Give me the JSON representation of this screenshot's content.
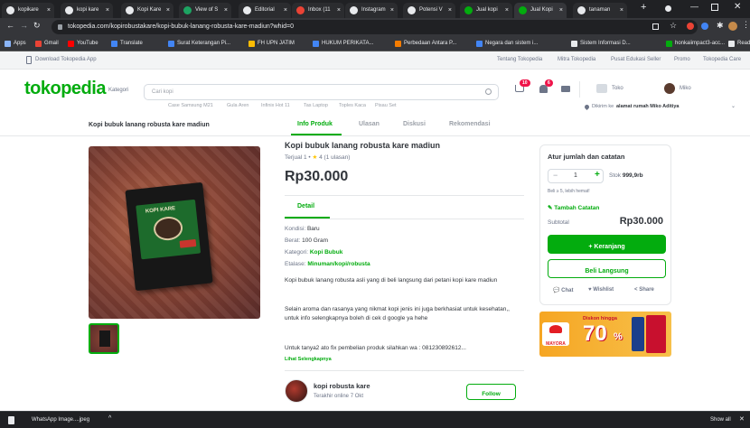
{
  "browser": {
    "tabs": [
      {
        "label": "kopikare",
        "color": "#e8eaed"
      },
      {
        "label": "kopi kare",
        "color": "#e8eaed"
      },
      {
        "label": "Kopi Kare",
        "color": "#e8eaed"
      },
      {
        "label": "View of S",
        "color": "#1da462"
      },
      {
        "label": "Editorial",
        "color": "#e8eaed"
      },
      {
        "label": "Inbox (11",
        "color": "#ea4335"
      },
      {
        "label": "Instagram",
        "color": "#e8eaed"
      },
      {
        "label": "Potensi V",
        "color": "#e8eaed"
      },
      {
        "label": "Jual kopi",
        "color": "#03ac0e"
      },
      {
        "label": "Jual Kopi",
        "color": "#03ac0e"
      },
      {
        "label": "tanaman",
        "color": "#e8eaed"
      }
    ],
    "url": "tokopedia.com/kopirobustakare/kopi-bubuk-lanang-robusta-kare-madiun?whid=0",
    "bookmarks": [
      {
        "label": "Apps",
        "color": "#8ab4f8"
      },
      {
        "label": "Gmail",
        "color": "#ea4335"
      },
      {
        "label": "YouTube",
        "color": "#ff0000"
      },
      {
        "label": "Translate",
        "color": "#4285f4"
      },
      {
        "label": "Surat Keterangan Pi...",
        "color": "#4285f4"
      },
      {
        "label": "FH UPN JATIM",
        "color": "#fbbc04"
      },
      {
        "label": "HUKUM PERIKATA...",
        "color": "#4285f4"
      },
      {
        "label": "Perbedaan Antara P...",
        "color": "#f57c00"
      },
      {
        "label": "Negara dan sistem i...",
        "color": "#4285f4"
      },
      {
        "label": "Sistem Informasi D...",
        "color": "#e8eaed"
      },
      {
        "label": "honkaiimpact3-acc...",
        "color": "#03ac0e"
      },
      {
        "label": "Reading list",
        "color": "#e8eaed"
      }
    ]
  },
  "topstrip": {
    "download_app": "Download Tokopedia App",
    "links": [
      "Tentang Tokopedia",
      "Mitra Tokopedia",
      "Pusat Edukasi Seller",
      "Promo",
      "Tokopedia Care"
    ]
  },
  "header": {
    "logo": "tokopedia",
    "category": "Kategori",
    "search_placeholder": "Cari kopi",
    "suggestions": [
      "Case Samsung M21",
      "Gula Aren",
      "Infinix Hot 11",
      "Tas Laptop",
      "Toples Kaca",
      "Pisau Set"
    ],
    "cart_badge": "10",
    "notif_badge": "6",
    "shop": "Toko",
    "user": "Miko",
    "ship_to_prefix": "Dikirim ke",
    "ship_to": "alamat rumah Miko Aditiya"
  },
  "subnav": {
    "product_title": "Kopi bubuk lanang robusta kare madiun",
    "tabs": [
      "Info Produk",
      "Ulasan",
      "Diskusi",
      "Rekomendasi"
    ]
  },
  "product": {
    "title": "Kopi bubuk lanang robusta kare madiun",
    "sold": "Terjual 1",
    "rating": "4",
    "reviews": "(1 ulasan)",
    "price": "Rp30.000",
    "detail_tab": "Detail",
    "kondisi_label": "Kondisi:",
    "kondisi": "Baru",
    "berat_label": "Berat:",
    "berat": "100 Gram",
    "kategori_label": "Kategori:",
    "kategori": "Kopi Bubuk",
    "etalase_label": "Etalase:",
    "etalase": "Minuman/kopi/robusta",
    "desc1": "Kopi bubuk lanang robusta asli yang di beli langsung dari petani kopi kare madiun",
    "desc2": "Selain aroma dan rasanya yang nikmat kopi jenis ini juga berkhasiat untuk kesehatan,, untuk info selengkapnya boleh di cek d google ya hehe",
    "desc3": "Untuk tanya2 ato fix pembelian produk silahkan wa : 081230892612...",
    "see_more": "Lihat Selengkapnya",
    "package_text": "KOPI KARE"
  },
  "seller": {
    "name": "kopi robusta kare",
    "status": "Terakhir online 7 Okt",
    "follow": "Follow"
  },
  "order": {
    "title": "Atur jumlah dan catatan",
    "qty": "1",
    "stock_label": "Stok",
    "stock": "999,9rb",
    "min_note": "Beli ≥ 5, lebih hemat!",
    "add_note": "Tambah Catatan",
    "subtotal_label": "Subtotal",
    "subtotal": "Rp30.000",
    "cart_button": "+ Keranjang",
    "buy_button": "Beli Langsung",
    "chat": "Chat",
    "wishlist": "Wishlist",
    "share": "Share"
  },
  "ad": {
    "brand": "MAYORA",
    "headline": "Diskon hingga",
    "discount": "70",
    "percent": "%"
  },
  "taskbar": {
    "download_name": "WhatsApp Image....jpeg",
    "show_all": "Show all"
  },
  "colors": {
    "brand": "#03ac0e",
    "chrome_dark": "#202124",
    "chrome": "#35363a"
  }
}
